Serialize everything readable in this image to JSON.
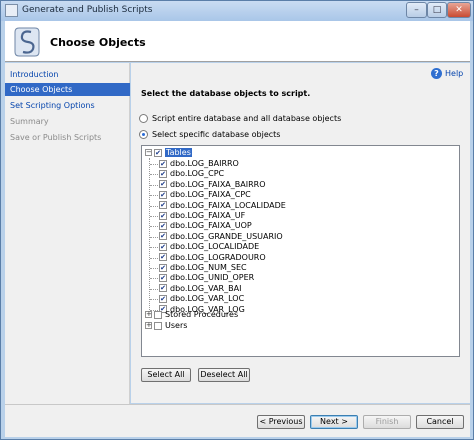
{
  "window": {
    "title": "Generate and Publish Scripts",
    "min_glyph": "–",
    "max_glyph": "□",
    "close_glyph": "✕"
  },
  "header": {
    "title": "Choose Objects"
  },
  "nav": {
    "items": [
      {
        "label": "Introduction",
        "state": "link"
      },
      {
        "label": "Choose Objects",
        "state": "active"
      },
      {
        "label": "Set Scripting Options",
        "state": "link"
      },
      {
        "label": "Summary",
        "state": "disabled"
      },
      {
        "label": "Save or Publish Scripts",
        "state": "disabled"
      }
    ]
  },
  "main": {
    "help_label": "Help",
    "help_glyph": "?",
    "instruction": "Select the database objects to script.",
    "radio_entire": "Script entire database and all database objects",
    "radio_specific": "Select specific database objects"
  },
  "tree": {
    "tables_label": "Tables",
    "tables": [
      "dbo.LOG_BAIRRO",
      "dbo.LOG_CPC",
      "dbo.LOG_FAIXA_BAIRRO",
      "dbo.LOG_FAIXA_CPC",
      "dbo.LOG_FAIXA_LOCALIDADE",
      "dbo.LOG_FAIXA_UF",
      "dbo.LOG_FAIXA_UOP",
      "dbo.LOG_GRANDE_USUARIO",
      "dbo.LOG_LOCALIDADE",
      "dbo.LOG_LOGRADOURO",
      "dbo.LOG_NUM_SEC",
      "dbo.LOG_UNID_OPER",
      "dbo.LOG_VAR_BAI",
      "dbo.LOG_VAR_LOC",
      "dbo.LOG_VAR_LOG"
    ],
    "stored_procedures_label": "Stored Procedures",
    "users_label": "Users",
    "collapse_glyph": "−",
    "expand_glyph": "+",
    "check_glyph": "✔"
  },
  "buttons": {
    "select_all": "Select All",
    "deselect_all": "Deselect All",
    "previous": "< Previous",
    "next": "Next >",
    "finish": "Finish",
    "cancel": "Cancel"
  }
}
